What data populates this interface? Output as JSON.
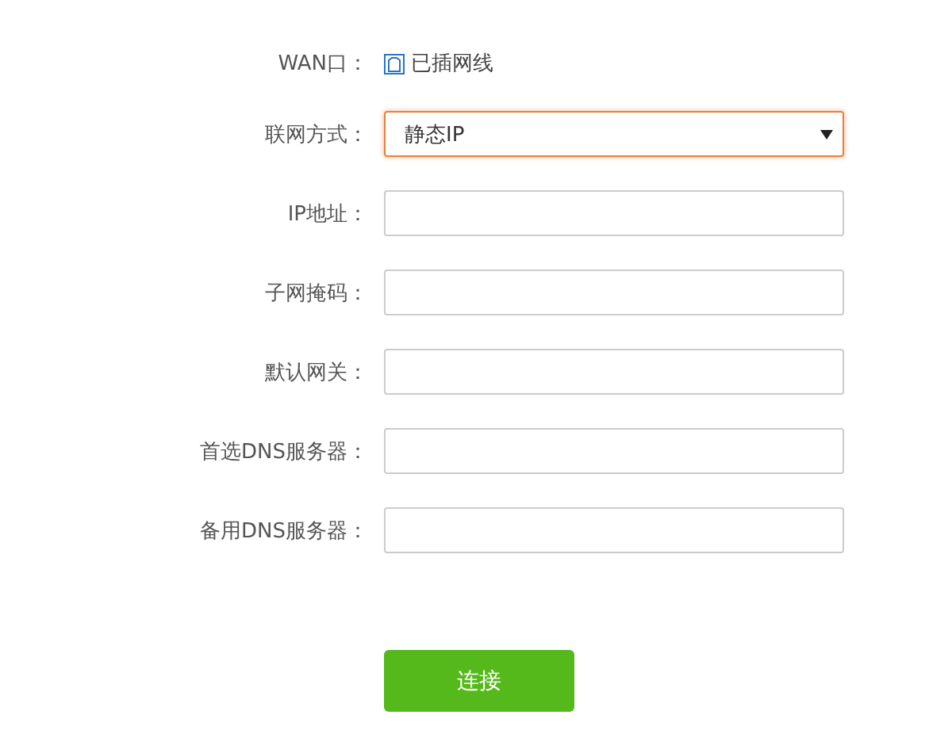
{
  "form": {
    "rows": [
      {
        "kind": "status",
        "label": "WAN口：",
        "value": "已插网线"
      },
      {
        "kind": "select",
        "label": "联网方式：",
        "value": "静态IP",
        "focused": true
      },
      {
        "kind": "input",
        "label": "IP地址："
      },
      {
        "kind": "input",
        "label": "子网掩码："
      },
      {
        "kind": "input",
        "label": "默认网关："
      },
      {
        "kind": "input",
        "label": "首选DNS服务器："
      },
      {
        "kind": "input",
        "label": "备用DNS服务器："
      }
    ],
    "submit": "连接"
  }
}
